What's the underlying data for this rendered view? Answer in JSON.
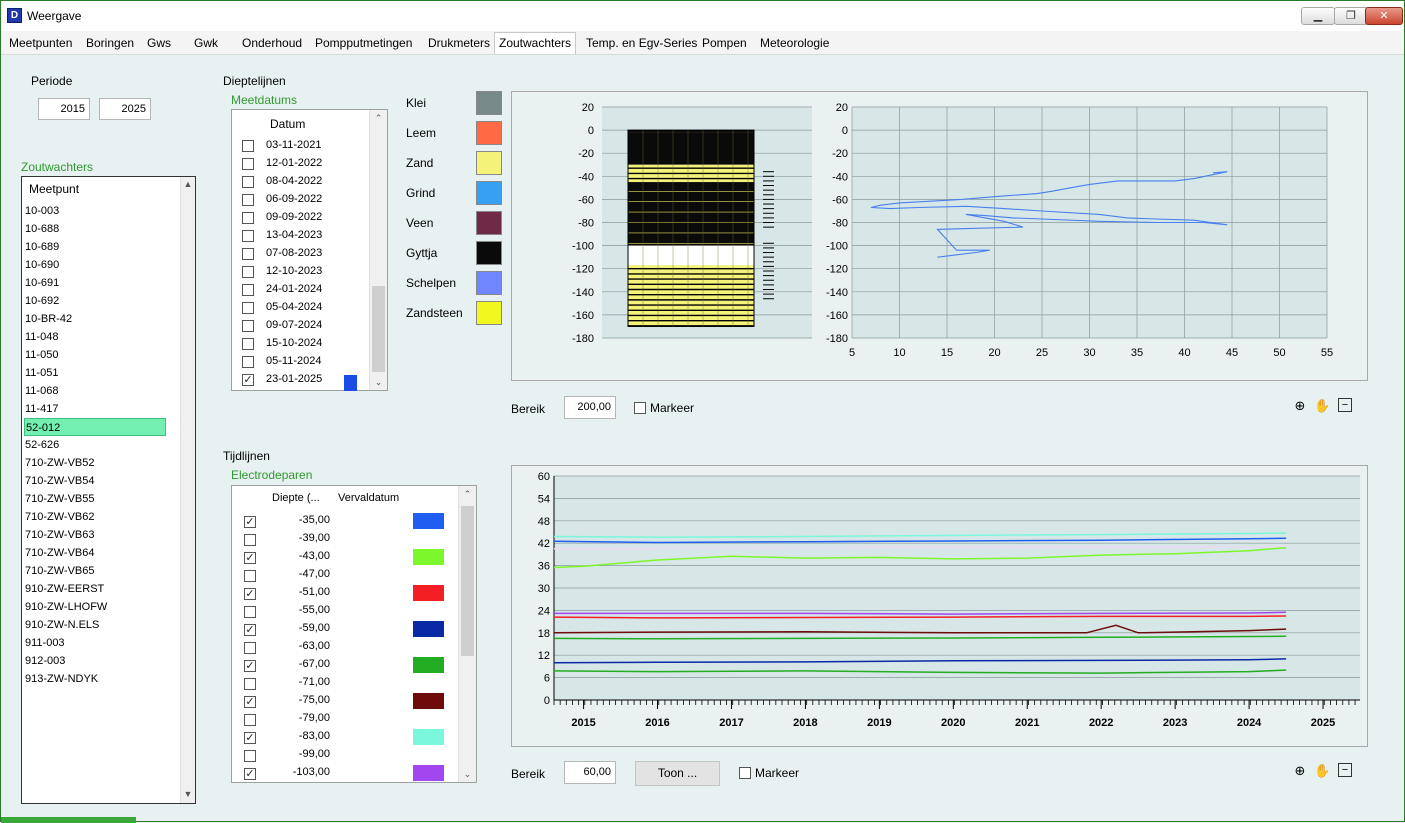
{
  "window": {
    "title": "Weergave",
    "icon_letter": "D"
  },
  "tabs": [
    "Meetpunten",
    "Boringen",
    "Gws",
    "Gwk",
    "Onderhoud",
    "Pompputmetingen",
    "Drukmeters",
    "Zoutwachters",
    "Temp. en Egv-Series",
    "Pompen",
    "Meteorologie"
  ],
  "active_tab": "Zoutwachters",
  "periode": {
    "label": "Periode",
    "from": "2015",
    "to": "2025"
  },
  "zoutwachters": {
    "title": "Zoutwachters",
    "column": "Meetpunt",
    "selected": "52-012",
    "items": [
      "10-003",
      "10-688",
      "10-689",
      "10-690",
      "10-691",
      "10-692",
      "10-BR-42",
      "11-048",
      "11-050",
      "11-051",
      "11-068",
      "11-417",
      "52-012",
      "52-626",
      "710-ZW-VB52",
      "710-ZW-VB54",
      "710-ZW-VB55",
      "710-ZW-VB62",
      "710-ZW-VB63",
      "710-ZW-VB64",
      "710-ZW-VB65",
      "910-ZW-EERST",
      "910-ZW-LHOFW",
      "910-ZW-N.ELS",
      "911-003",
      "912-003",
      "913-ZW-NDYK"
    ]
  },
  "dieptelijnen": {
    "title": "Dieptelijnen",
    "meetdatums_title": "Meetdatums",
    "column": "Datum",
    "dates": [
      {
        "date": "03-11-2021",
        "checked": false
      },
      {
        "date": "12-01-2022",
        "checked": false
      },
      {
        "date": "08-04-2022",
        "checked": false
      },
      {
        "date": "06-09-2022",
        "checked": false
      },
      {
        "date": "09-09-2022",
        "checked": false
      },
      {
        "date": "13-04-2023",
        "checked": false
      },
      {
        "date": "07-08-2023",
        "checked": false
      },
      {
        "date": "12-10-2023",
        "checked": false
      },
      {
        "date": "24-01-2024",
        "checked": false
      },
      {
        "date": "05-04-2024",
        "checked": false
      },
      {
        "date": "09-07-2024",
        "checked": false
      },
      {
        "date": "15-10-2024",
        "checked": false
      },
      {
        "date": "05-11-2024",
        "checked": false
      },
      {
        "date": "23-01-2025",
        "checked": true,
        "color": "#1a4de6"
      }
    ],
    "legend": [
      {
        "name": "Klei",
        "color": "#778a88"
      },
      {
        "name": "Leem",
        "color": "#ff6a45"
      },
      {
        "name": "Zand",
        "color": "#f5f27a"
      },
      {
        "name": "Grind",
        "color": "#38a0f2"
      },
      {
        "name": "Veen",
        "color": "#6f2a45"
      },
      {
        "name": "Gyttja",
        "color": "#0a0a0a"
      },
      {
        "name": "Schelpen",
        "color": "#6f86ff"
      },
      {
        "name": "Zandsteen",
        "color": "#f2f720"
      }
    ],
    "bereik_label": "Bereik",
    "bereik_value": "200,00",
    "markeer_label": "Markeer"
  },
  "tijdlijnen": {
    "title": "Tijdlijnen",
    "electrodeparen_title": "Electrodeparen",
    "col_diepte": "Diepte (...",
    "col_vervaldatum": "Vervaldatum",
    "pairs": [
      {
        "depth": "-35,00",
        "checked": true,
        "color": "#1f5ef0"
      },
      {
        "depth": "-39,00",
        "checked": false
      },
      {
        "depth": "-43,00",
        "checked": true,
        "color": "#7cf72b"
      },
      {
        "depth": "-47,00",
        "checked": false
      },
      {
        "depth": "-51,00",
        "checked": true,
        "color": "#f41f24"
      },
      {
        "depth": "-55,00",
        "checked": false
      },
      {
        "depth": "-59,00",
        "checked": true,
        "color": "#0a2aa5"
      },
      {
        "depth": "-63,00",
        "checked": false
      },
      {
        "depth": "-67,00",
        "checked": true,
        "color": "#23ad22"
      },
      {
        "depth": "-71,00",
        "checked": false
      },
      {
        "depth": "-75,00",
        "checked": true,
        "color": "#6e0c0c"
      },
      {
        "depth": "-79,00",
        "checked": false
      },
      {
        "depth": "-83,00",
        "checked": true,
        "color": "#7af7dc"
      },
      {
        "depth": "-99,00",
        "checked": false
      },
      {
        "depth": "-103,00",
        "checked": true,
        "color": "#a247ef"
      }
    ],
    "bereik_label": "Bereik",
    "bereik_value": "60,00",
    "toon_label": "Toon ...",
    "markeer_label": "Markeer"
  },
  "chart_data": [
    {
      "type": "bar",
      "ylim": [
        -180,
        20
      ],
      "yticks": [
        "20",
        "0",
        "-20",
        "-40",
        "-60",
        "-80",
        "-100",
        "-120",
        "-140",
        "-160",
        "-180"
      ],
      "description_values": "lithology column, 0 to -170",
      "layers": [
        {
          "from": 0,
          "to": -2,
          "litho": "Gyttja"
        },
        {
          "from": -2,
          "to": -30,
          "litho": "Gyttja"
        },
        {
          "from": -30,
          "to": -45,
          "litho": "Zand"
        },
        {
          "from": -45,
          "to": -100,
          "litho": "Gyttja"
        },
        {
          "from": -100,
          "to": -117,
          "litho": "Onbekend"
        },
        {
          "from": -117,
          "to": -170,
          "litho": "Zand"
        }
      ],
      "sensor_marks_top": [
        -36,
        -84
      ],
      "sensor_marks_bottom": [
        -98,
        -148
      ]
    },
    {
      "type": "line",
      "xlim": [
        5,
        55
      ],
      "ylim": [
        -180,
        20
      ],
      "xticks": [
        "5",
        "10",
        "15",
        "20",
        "25",
        "30",
        "35",
        "40",
        "45",
        "50",
        "55"
      ],
      "yticks": [
        "20",
        "0",
        "-20",
        "-40",
        "-60",
        "-80",
        "-100",
        "-120",
        "-140",
        "-160",
        "-180"
      ],
      "series": [
        {
          "color": "#4a7ff0",
          "x": [
            43,
            44.5,
            41,
            39,
            33,
            30,
            28,
            26,
            24.5,
            21,
            16.5,
            10,
            8,
            7,
            9,
            12,
            17,
            21,
            25,
            31,
            34,
            37,
            41,
            44.5,
            44.5,
            42,
            40,
            39,
            37,
            31,
            25,
            22,
            19,
            17,
            21,
            23,
            18,
            14,
            16,
            19.5,
            18,
            14
          ],
          "y": [
            -37,
            -36,
            -42,
            -44,
            -44,
            -47,
            -50,
            -53,
            -55,
            -57,
            -60,
            -63,
            -65,
            -67,
            -68,
            -67,
            -66,
            -68,
            -70,
            -73,
            -76,
            -77,
            -78,
            -82,
            -82,
            -80,
            -80,
            -80,
            -80,
            -79,
            -77,
            -76,
            -74,
            -73,
            -79,
            -84,
            -85,
            -86,
            -104,
            -104,
            -106,
            -110
          ]
        }
      ]
    },
    {
      "type": "line",
      "xlim": [
        2014.6,
        2025.5
      ],
      "ylim": [
        0,
        60
      ],
      "xticks": [
        "2015",
        "2016",
        "2017",
        "2018",
        "2019",
        "2020",
        "2021",
        "2022",
        "2023",
        "2024",
        "2025"
      ],
      "yticks": [
        "0",
        "6",
        "12",
        "18",
        "24",
        "30",
        "36",
        "42",
        "48",
        "54",
        "60"
      ],
      "series": [
        {
          "color": "#1f5ef0",
          "x": [
            2014.6,
            2016,
            2018,
            2020,
            2022,
            2024,
            2024.5
          ],
          "y": [
            42.5,
            42.2,
            42.4,
            42.6,
            42.8,
            43.2,
            43.3
          ]
        },
        {
          "color": "#7af7dc",
          "x": [
            2014.6,
            2016,
            2018,
            2020,
            2022,
            2024,
            2024.5
          ],
          "y": [
            43.8,
            43.6,
            43.8,
            44.1,
            44.3,
            44.6,
            44.7
          ]
        },
        {
          "color": "#ebd9f3",
          "x": [
            2014.6,
            2016,
            2018,
            2020,
            2022,
            2024,
            2024.5
          ],
          "y": [
            40.5,
            40.6,
            40.8,
            40.9,
            41.0,
            41.0,
            41.2
          ]
        },
        {
          "color": "#7cf72b",
          "x": [
            2014.6,
            2015,
            2016,
            2017,
            2018,
            2019,
            2020,
            2021,
            2022,
            2023,
            2024,
            2024.5
          ],
          "y": [
            35.5,
            35.8,
            37.5,
            38.5,
            38.0,
            38.2,
            37.8,
            38.0,
            38.8,
            39.2,
            40.0,
            40.8
          ]
        },
        {
          "color": "#a247ef",
          "x": [
            2014.6,
            2016,
            2018,
            2020,
            2022,
            2024,
            2024.5
          ],
          "y": [
            23.2,
            23.2,
            23.2,
            23.0,
            23.2,
            23.3,
            23.5
          ]
        },
        {
          "color": "#f41f24",
          "x": [
            2014.6,
            2016,
            2018,
            2020,
            2022,
            2024,
            2024.5
          ],
          "y": [
            22.2,
            22.0,
            22.1,
            22.2,
            22.4,
            22.4,
            22.5
          ]
        },
        {
          "color": "#6e0c0c",
          "x": [
            2014.6,
            2016,
            2018,
            2020,
            2021.8,
            2022.2,
            2022.5,
            2024,
            2024.5
          ],
          "y": [
            18.0,
            18.2,
            18.3,
            18.0,
            18.0,
            20.0,
            18.0,
            18.6,
            19.0
          ]
        },
        {
          "color": "#23ad22",
          "x": [
            2014.6,
            2016,
            2018,
            2020,
            2022,
            2024,
            2024.5
          ],
          "y": [
            16.5,
            16.4,
            16.5,
            16.6,
            16.8,
            17.0,
            17.1
          ]
        },
        {
          "color": "#0a2aa5",
          "x": [
            2014.6,
            2016,
            2018,
            2020,
            2022,
            2024,
            2024.5
          ],
          "y": [
            10.0,
            10.1,
            10.2,
            10.5,
            10.6,
            10.8,
            11.0
          ]
        },
        {
          "color": "#23ad22",
          "x": [
            2014.6,
            2016,
            2018,
            2020,
            2022,
            2024,
            2024.5
          ],
          "y": [
            7.8,
            7.6,
            7.8,
            7.4,
            7.2,
            7.6,
            8.0
          ]
        }
      ]
    }
  ]
}
